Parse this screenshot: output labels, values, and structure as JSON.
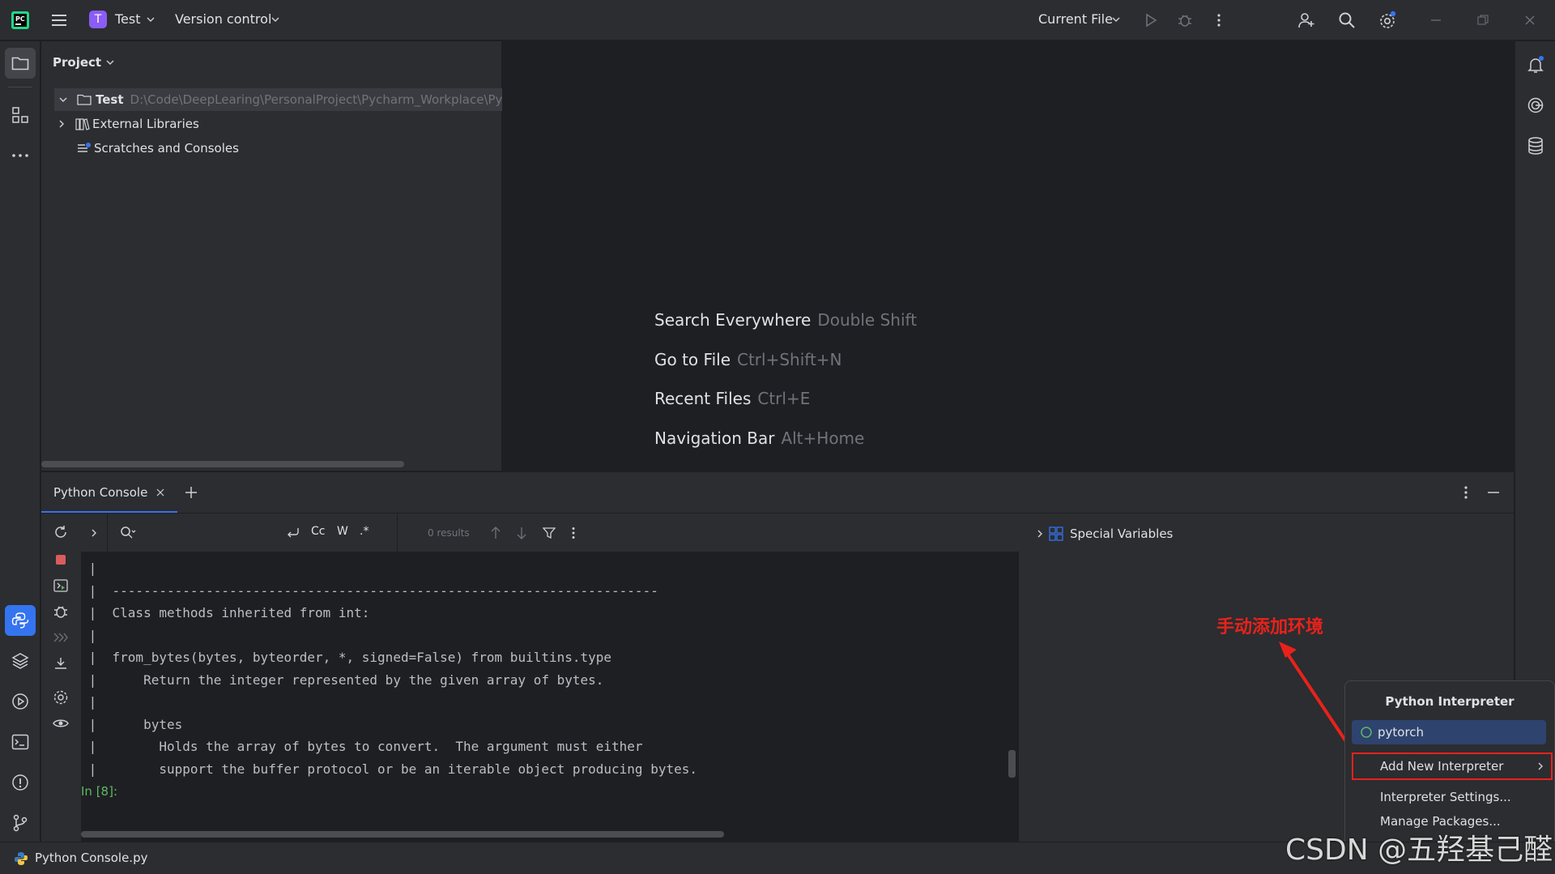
{
  "titlebar": {
    "project_initial": "T",
    "project_name": "Test",
    "vcs_label": "Version control",
    "run_config": "Current File"
  },
  "project_panel": {
    "title": "Project",
    "tree": {
      "root_name": "Test",
      "root_path": "D:\\Code\\DeepLearing\\PersonalProject\\Pycharm_Workplace\\Pyc",
      "external_libraries": "External Libraries",
      "scratches": "Scratches and Consoles"
    }
  },
  "editor_hints": [
    {
      "label": "Search Everywhere",
      "shortcut": "Double Shift"
    },
    {
      "label": "Go to File",
      "shortcut": "Ctrl+Shift+N"
    },
    {
      "label": "Recent Files",
      "shortcut": "Ctrl+E"
    },
    {
      "label": "Navigation Bar",
      "shortcut": "Alt+Home"
    }
  ],
  "console": {
    "tab_label": "Python Console",
    "search": {
      "results": "0 results",
      "case_label": "Cc",
      "word_label": "W",
      "regex_label": ".*"
    },
    "lines": [
      " |",
      " |  ----------------------------------------------------------------------",
      " |  Class methods inherited from int:",
      " |",
      " |  from_bytes(bytes, byteorder, *, signed=False) from builtins.type",
      " |      Return the integer represented by the given array of bytes.",
      " |",
      " |      bytes",
      " |        Holds the array of bytes to convert.  The argument must either",
      " |        support the buffer protocol or be an iterable object producing bytes."
    ],
    "prompt": "In [8]:"
  },
  "variables": {
    "special_variables": "Special Variables"
  },
  "annotation": {
    "text": "手动添加环境",
    "color": "#e8221b"
  },
  "interpreter_popup": {
    "title": "Python Interpreter",
    "current": "pytorch",
    "items": [
      "Add New Interpreter",
      "Interpreter Settings...",
      "Manage Packages..."
    ]
  },
  "status_bar": {
    "file": "Python Console.py"
  },
  "watermark": "CSDN @五羟基己醛",
  "colors": {
    "accent": "#3574f0",
    "project_badge": "#8b5cf6",
    "selection": "#2e436e",
    "prompt_green": "#5fb865"
  }
}
